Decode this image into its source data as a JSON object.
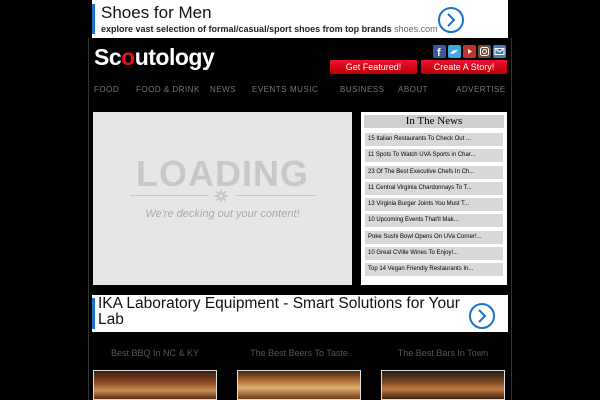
{
  "ad_top": {
    "title": "Shoes for Men",
    "description": "explore vast selection of formal/casual/sport shoes from top brands",
    "domain": "shoes.com"
  },
  "logo": {
    "part1": "Sc",
    "part2": "o",
    "part3": "utology"
  },
  "social_icons": [
    "facebook-icon",
    "twitter-icon",
    "youtube-icon",
    "instagram-icon",
    "email-icon"
  ],
  "buttons": {
    "get_featured": "Get Featured!",
    "create_story": "Create A Story!"
  },
  "nav": [
    "FOOD",
    "FOOD & DRINK",
    "NEWS",
    "EVENTS",
    "MUSIC",
    "BUSINESS",
    "ABOUT",
    "ADVERTISE"
  ],
  "loading": {
    "title": "LOADING",
    "subtitle": "We're decking out your content!"
  },
  "news": {
    "heading": "In The News",
    "items": [
      "15 Italian Restaurants To Check Out ...",
      "11 Spots To Watch UVA Sports in Char...",
      "23 Of The Best Executive Chefs In Ch...",
      "11 Central Virginia Chardonnays To T...",
      "13 Virginia Burger Joints You Must T...",
      "10 Upcoming Events That'll Mak...",
      "Poke Sushi Bowl Opens On UVa Corner!...",
      "10 Great CVille Wines To Enjoy!...",
      "Top 14 Vegan Friendly Restaurants In..."
    ]
  },
  "ad_mid": {
    "title": "IKA Laboratory Equipment - Smart Solutions for Your Lab"
  },
  "cards": [
    "Best BBQ In NC & KY",
    "The Best Beers To Taste",
    "The Best Bars In Town"
  ],
  "colors": {
    "accent": "#dd1122",
    "ad_blue": "#1a73c9"
  }
}
